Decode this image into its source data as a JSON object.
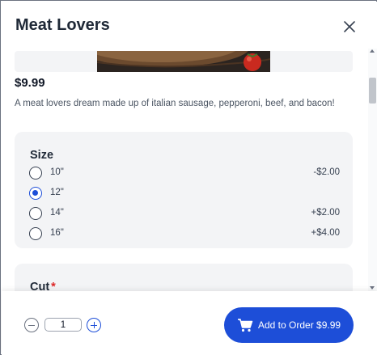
{
  "dialog": {
    "title": "Meat Lovers",
    "close_icon": "close-icon"
  },
  "item": {
    "image_icon": "pizza-photo",
    "price": "$9.99",
    "description": "A meat lovers dream made up of italian sausage, pepperoni, beef, and bacon!"
  },
  "size": {
    "title": "Size",
    "options": [
      {
        "label": "10\"",
        "price": "-$2.00",
        "selected": false
      },
      {
        "label": "12\"",
        "price": "",
        "selected": true
      },
      {
        "label": "14\"",
        "price": "+$2.00",
        "selected": false
      },
      {
        "label": "16\"",
        "price": "+$4.00",
        "selected": false
      }
    ]
  },
  "cut": {
    "title": "Cut",
    "required_marker": "*"
  },
  "footer": {
    "quantity": "1",
    "minus_icon": "minus-circle-icon",
    "plus_icon": "plus-circle-icon",
    "add_button_label": "Add to Order $9.99",
    "cart_icon": "cart-icon"
  },
  "colors": {
    "accent": "#1d4ed8",
    "required": "#dc2626",
    "card_bg": "#f3f4f6"
  }
}
